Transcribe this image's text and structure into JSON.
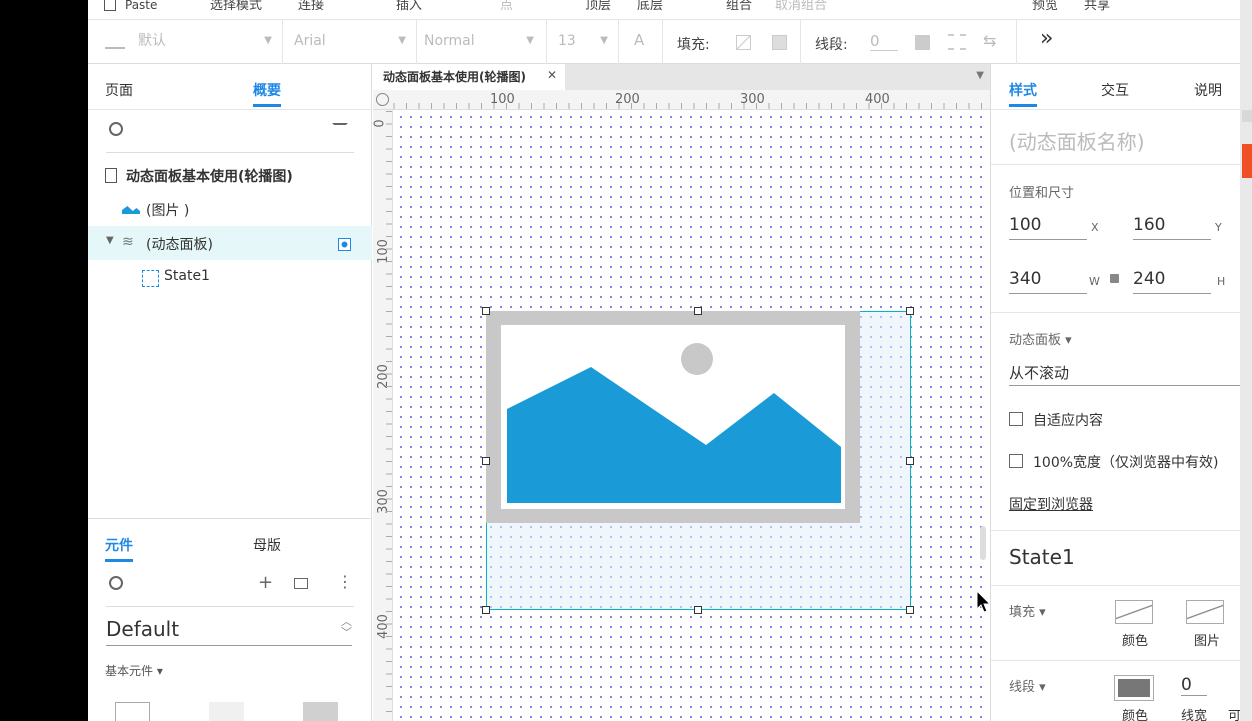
{
  "menu": {
    "paste": "Paste",
    "items": [
      "选择模式",
      "连接",
      "插入",
      "点",
      "顶层",
      "底层",
      "组合",
      "取消组合",
      "预览",
      "共享"
    ]
  },
  "toolbar": {
    "style_select": "默认",
    "font_select": "Arial",
    "weight_select": "Normal",
    "size_select": "13",
    "fill_label": "填充:",
    "stroke_label": "线段:",
    "stroke_value": "0",
    "more": "»"
  },
  "left_panel": {
    "tabs": [
      "页面",
      "概要"
    ],
    "active_tab": "概要",
    "tree": {
      "page": "动态面板基本使用(轮播图)",
      "image": "(图片 )",
      "panel": "(动态面板)",
      "state": "State1"
    },
    "lib_tabs": [
      "元件",
      "母版"
    ],
    "lib_active": "元件",
    "library_select": "Default",
    "basic_widgets": "基本元件 ▾"
  },
  "canvas": {
    "tab_title": "动态面板基本使用(轮播图)",
    "ruler_h": [
      "100",
      "200",
      "300",
      "400"
    ],
    "ruler_v": [
      "0",
      "100",
      "200",
      "300",
      "400"
    ]
  },
  "right_panel": {
    "tabs": [
      "样式",
      "交互",
      "说明"
    ],
    "active_tab": "样式",
    "name_placeholder": "(动态面板名称)",
    "position_label": "位置和尺寸",
    "x": "100",
    "x_unit": "X",
    "y": "160",
    "y_unit": "Y",
    "w": "340",
    "w_unit": "W",
    "h": "240",
    "h_unit": "H",
    "panel_section": "动态面板 ▾",
    "scroll_value": "从不滚动",
    "fit_content": "自适应内容",
    "full_width": "100%宽度（仅浏览器中有效)",
    "pin_link": "固定到浏览器",
    "state_name": "State1",
    "fill_section": "填充 ▾",
    "fill_color": "颜色",
    "fill_image": "图片",
    "stroke_section": "线段 ▾",
    "stroke_color": "颜色",
    "stroke_width_label": "线宽",
    "stroke_width": "0",
    "stroke_extra": "可"
  },
  "colors": {
    "accent": "#1e88e5",
    "selection": "#00b7c3",
    "image_blue": "#1a9bd7",
    "image_gray": "#c8c8c8"
  }
}
